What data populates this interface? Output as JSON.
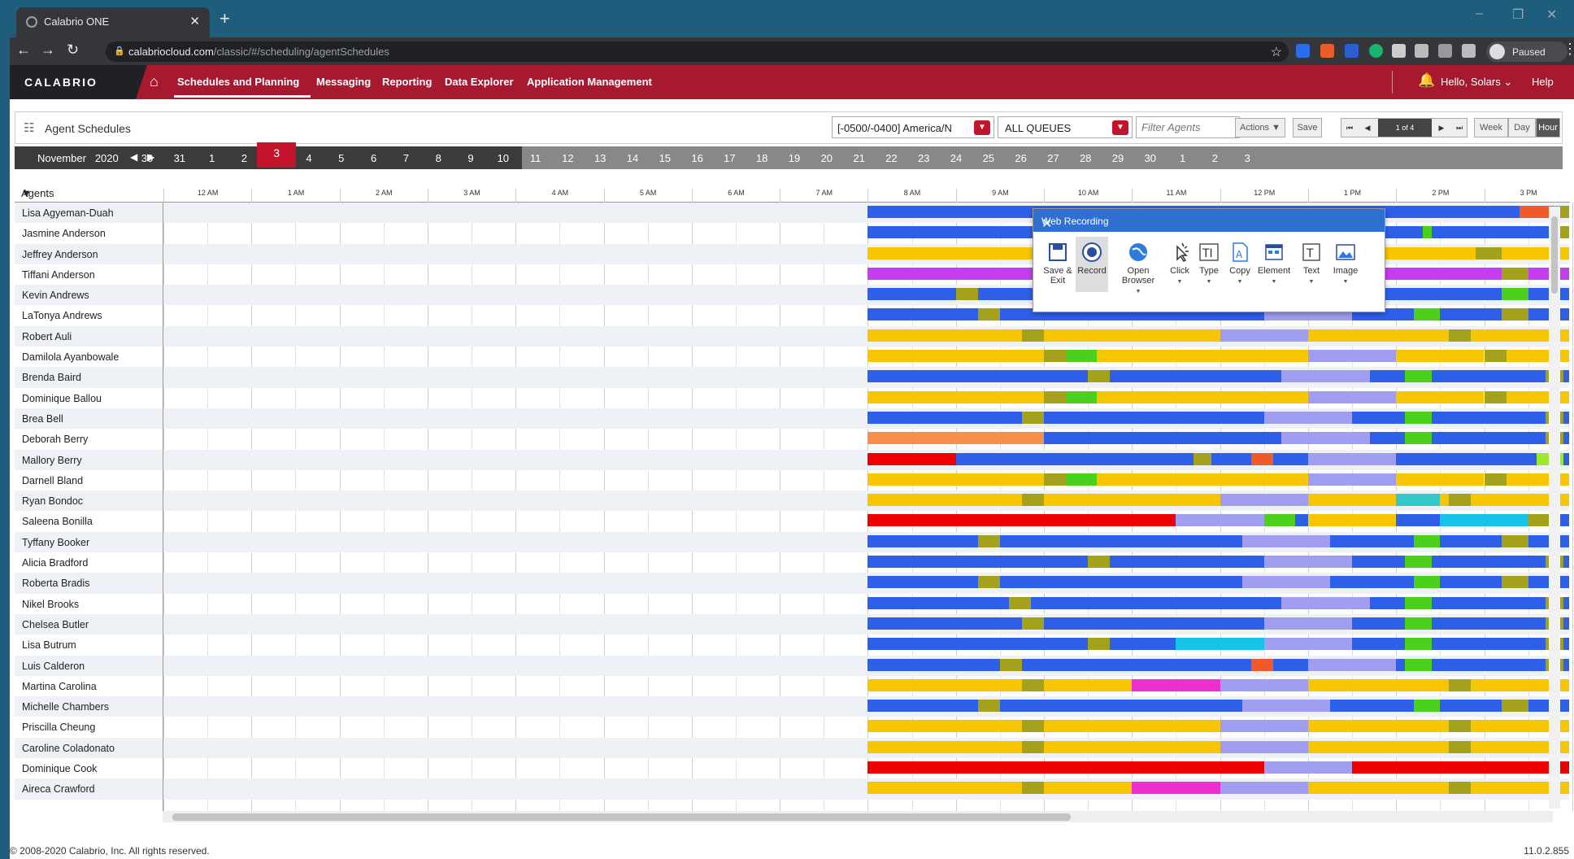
{
  "browser": {
    "tab_title": "Calabrio ONE",
    "url_host": "calabriocloud.com",
    "url_path": "/classic/#/scheduling/agentSchedules",
    "profile_label": "Paused"
  },
  "header": {
    "logo": "CALABRIO",
    "nav": [
      "Schedules and Planning",
      "Messaging",
      "Reporting",
      "Data Explorer",
      "Application Management"
    ],
    "greeting": "Hello, Solars",
    "help": "Help"
  },
  "toolbar": {
    "title": "Agent Schedules",
    "timezone": "[-0500/-0400] America/N",
    "queue": "ALL QUEUES",
    "filter_placeholder": "Filter Agents",
    "actions_label": "Actions ▼",
    "save_label": "Save",
    "page_label": "1 of 4",
    "views": [
      "Week",
      "Day",
      "Hour"
    ],
    "active_view": "Hour"
  },
  "date_strip": {
    "month": "November",
    "year": "2020",
    "days": [
      "30",
      "31",
      "1",
      "2",
      "3",
      "4",
      "5",
      "6",
      "7",
      "8",
      "9",
      "10",
      "11",
      "12",
      "13",
      "14",
      "15",
      "16",
      "17",
      "18",
      "19",
      "20",
      "21",
      "22",
      "23",
      "24",
      "25",
      "26",
      "27",
      "28",
      "29",
      "30",
      "1",
      "2",
      "3"
    ],
    "selected_day": "3"
  },
  "grid": {
    "agents_header": "Agents",
    "hours": [
      "12 AM",
      "1 AM",
      "2 AM",
      "3 AM",
      "4 AM",
      "5 AM",
      "6 AM",
      "7 AM",
      "8 AM",
      "9 AM",
      "10 AM",
      "11 AM",
      "12 PM",
      "1 PM",
      "2 PM",
      "3 PM"
    ],
    "agents": [
      "Lisa Agyeman-Duah",
      "Jasmine Anderson",
      "Jeffrey Anderson",
      "Tiffani Anderson",
      "Kevin Andrews",
      "LaTonya Andrews",
      "Robert Auli",
      "Damilola Ayanbowale",
      "Brenda Baird",
      "Dominique Ballou",
      "Brea Bell",
      "Deborah Berry",
      "Mallory Berry",
      "Darnell Bland",
      "Ryan Bondoc",
      "Saleena Bonilla",
      "Tyffany Booker",
      "Alicia Bradford",
      "Roberta Bradis",
      "Nikel Brooks",
      "Chelsea Butler",
      "Lisa Butrum",
      "Luis Calderon",
      "Martina Carolina",
      "Michelle Chambers",
      "Priscilla Cheung",
      "Caroline Coladonato",
      "Dominique Cook",
      "Aireca Crawford"
    ]
  },
  "colors": {
    "blue": "#2e5fe8",
    "yellow": "#f7c600",
    "olive": "#a4a11c",
    "lavender": "#9f9ef0",
    "green": "#4bd11b",
    "purple": "#c43df0",
    "orange": "#f5914a",
    "red": "#ee0000",
    "magenta": "#ee2fcf",
    "cyan": "#17c3e8",
    "teal": "#34c7c7",
    "lime": "#9be82e",
    "salmon": "#f05a2a",
    "brand": "#a6192e"
  },
  "popup": {
    "title": "Web Recording",
    "tools": [
      "Save & Exit",
      "Record",
      "Open Browser",
      "Click",
      "Type",
      "Copy",
      "Element",
      "Text",
      "Image"
    ]
  },
  "footer": {
    "copyright": "© 2008-2020 Calabrio, Inc. All rights reserved.",
    "version": "11.0.2.855"
  }
}
